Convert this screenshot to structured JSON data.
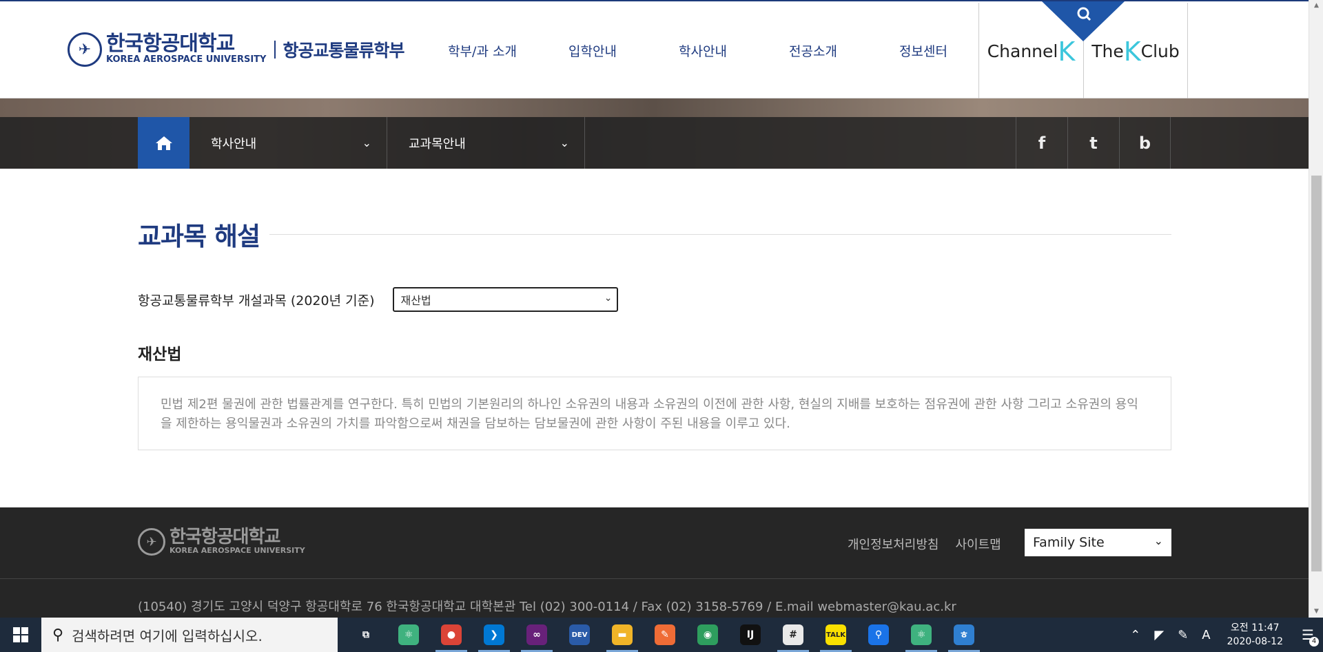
{
  "header": {
    "logo_kor": "한국항공대학교",
    "logo_eng": "KOREA AEROSPACE UNIVERSITY",
    "dept_name": "항공교통물류학부",
    "nav": [
      "학부/과 소개",
      "입학안내",
      "학사안내",
      "전공소개",
      "정보센터"
    ],
    "channel_pre": "Channel",
    "channel_k": "K",
    "club_pre": "The",
    "club_k": "K",
    "club_post": "Club",
    "search_icon": "search-icon",
    "colors": {
      "brand": "#1f3b80",
      "accent": "#3cc6dc"
    }
  },
  "subnav": {
    "home_icon": "home-icon",
    "dropdown1": "학사안내",
    "dropdown2": "교과목안내",
    "sns": [
      "facebook-icon",
      "twitter-icon",
      "blog-icon"
    ],
    "sns_glyphs": [
      "f",
      "t",
      "b"
    ]
  },
  "content": {
    "page_title": "교과목 해설",
    "filter_label": "항공교통물류학부 개설과목 (2020년 기준)",
    "filter_value": "재산법",
    "subject_title": "재산법",
    "description": "민법 제2편 물권에 관한 법률관계를 연구한다. 특히 민법의 기본원리의 하나인 소유권의 내용과 소유권의 이전에 관한 사항, 현실의 지배를 보호하는 점유권에 관한 사항 그리고 소유권의 용익을 제한하는 용익물권과 소유권의 가치를 파악함으로써 채권을 담보하는 담보물권에 관한 사항이 주된 내용을 이루고 있다."
  },
  "footer": {
    "logo_kor": "한국항공대학교",
    "logo_eng": "KOREA AEROSPACE UNIVERSITY",
    "links": [
      "개인정보처리방침",
      "사이트맵"
    ],
    "family_site": "Family Site",
    "address": "(10540) 경기도 고양시 덕양구 항공대학로 76 한국항공대학교 대학본관 Tel (02) 300-0114 / Fax (02) 3158-5769 / E.mail webmaster@kau.ac.kr"
  },
  "taskbar": {
    "search_placeholder": "검색하려면 여기에 입력하십시오.",
    "apps": [
      {
        "name": "task-view-icon",
        "glyph": "⧉",
        "color": "transparent"
      },
      {
        "name": "atom-icon",
        "glyph": "⚛",
        "color": "#3fb27f"
      },
      {
        "name": "chrome-icon",
        "glyph": "●",
        "color": "#db4437"
      },
      {
        "name": "vscode-icon",
        "glyph": "❯",
        "color": "#0078d4"
      },
      {
        "name": "visual-studio-icon",
        "glyph": "∞",
        "color": "#68217a"
      },
      {
        "name": "devexpress-icon",
        "glyph": "DEV",
        "color": "#2a5ba8"
      },
      {
        "name": "file-explorer-icon",
        "glyph": "▬",
        "color": "#f0b428"
      },
      {
        "name": "postman-icon",
        "glyph": "✎",
        "color": "#ef6c36"
      },
      {
        "name": "maps-icon",
        "glyph": "◉",
        "color": "#2e9e5e"
      },
      {
        "name": "intellij-icon",
        "glyph": "IJ",
        "color": "#111111"
      },
      {
        "name": "slack-icon",
        "glyph": "#",
        "color": "#e9e9e9"
      },
      {
        "name": "kakaotalk-icon",
        "glyph": "TALK",
        "color": "#f9e000"
      },
      {
        "name": "location-icon",
        "glyph": "⚲",
        "color": "#1a73e8"
      },
      {
        "name": "atom2-icon",
        "glyph": "⚛",
        "color": "#3fb27f"
      },
      {
        "name": "hwp-icon",
        "glyph": "ㅎ",
        "color": "#2f7fd1"
      }
    ],
    "tray_ime": "A",
    "clock_time": "오전 11:47",
    "clock_date": "2020-08-12",
    "notif_count": "4"
  }
}
